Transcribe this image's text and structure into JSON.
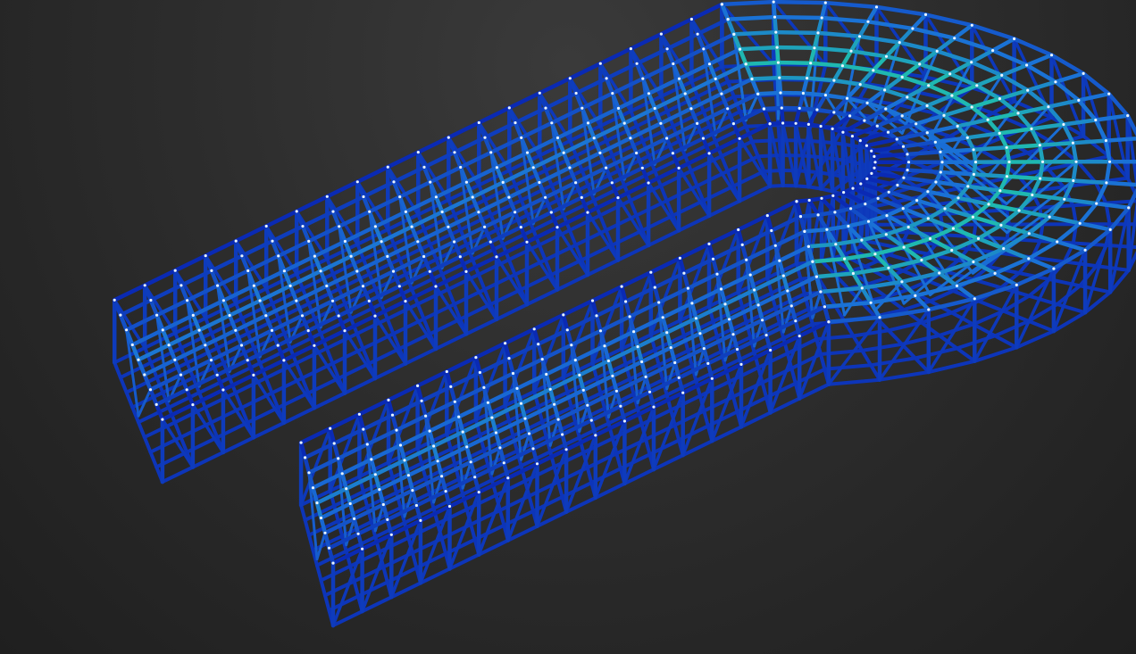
{
  "scene": {
    "subject": "u-shaped-lattice-mesh",
    "background_color": "#2b2b2b",
    "colors": {
      "edge_low": "#0a2ab4",
      "edge_mid": "#1a6fd6",
      "edge_high": "#1fb8b0",
      "node": "#e8f4ff"
    }
  }
}
